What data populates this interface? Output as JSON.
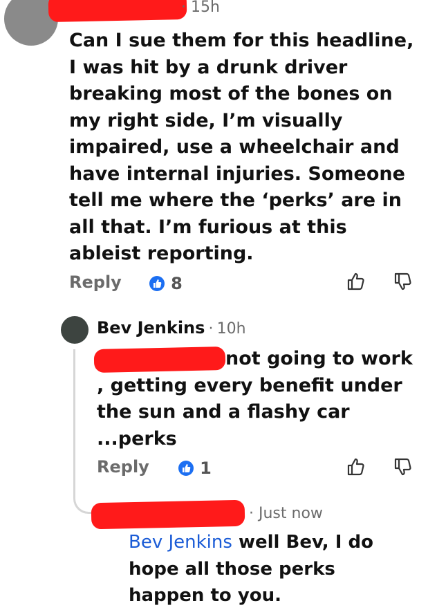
{
  "comment1": {
    "time": "15h",
    "text": "Can I sue them for this headline, I was hit by a drunk driver breaking most of the bones on my right side, I’m visually impaired, use a wheelchair and have internal injuries. Someone tell me where the ‘perks’ are in all that. I’m furious at this ableist reporting.",
    "reply_label": "Reply",
    "likes": "8"
  },
  "comment2": {
    "author": "Bev Jenkins",
    "time": "10h",
    "text": "not going to work , getting every benefit under the sun and a flashy car ...perks",
    "reply_label": "Reply",
    "likes": "1"
  },
  "comment3": {
    "time": "Just now",
    "mention": "Bev Jenkins",
    "text": " well Bev, I do hope all those perks happen to you."
  },
  "separator": "·",
  "colors": {
    "redaction": "#ff1a1a",
    "like_badge": "#1c6ff2",
    "mention": "#1a5bd6"
  },
  "icons": [
    "thumbs-up-icon",
    "thumbs-down-icon",
    "like-badge-icon"
  ]
}
